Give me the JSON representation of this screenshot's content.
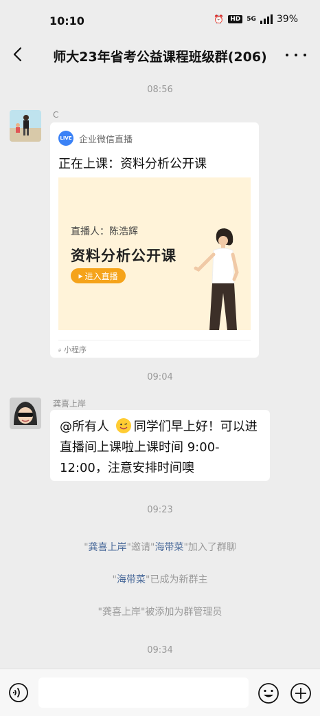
{
  "status": {
    "time": "10:10",
    "hd": "HD",
    "net": "5G",
    "battery": "39%"
  },
  "nav": {
    "title": "师大23年省考公益课程班级群(206)"
  },
  "messages": {
    "ts1": "08:56",
    "sender1": "C",
    "card": {
      "source": "企业微信直播",
      "live_badge": "LIVE",
      "title": "正在上课：资料分析公开课",
      "host": "直播人：陈浩辉",
      "course": "资料分析公开课",
      "enter": "进入直播",
      "footer": "小程序"
    },
    "ts2": "09:04",
    "sender2": "龚喜上岸",
    "text_part1": "@所有人",
    "text_part2": "同学们早上好！可以进直播间上课啦上课时间 9:00-12:00，注意安排时间噢",
    "ts3": "09:23",
    "sys1": {
      "q1": "\"",
      "name1": "龚喜上岸",
      "mid": "\"邀请\"",
      "name2": "海带菜",
      "end": "\"加入了群聊"
    },
    "sys2": {
      "q1": "\"",
      "name": "海带菜",
      "end": "\"已成为新群主"
    },
    "sys3": "\"龚喜上岸\"被添加为群管理员",
    "ts4": "09:34"
  },
  "colors": {
    "background": "#ededed",
    "live_blue": "#3b82f6",
    "enter_orange": "#f5a31a",
    "link": "#4a6a9a"
  }
}
